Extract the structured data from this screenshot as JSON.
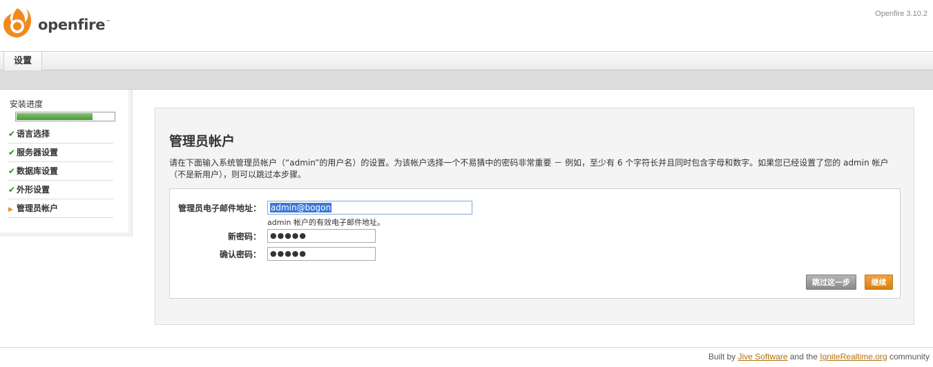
{
  "header": {
    "logo_text": "openfire",
    "logo_tm": "™",
    "version": "Openfire 3.10.2"
  },
  "tabs": [
    {
      "label": "设置"
    }
  ],
  "sidebar": {
    "progress_label": "安装进度",
    "progress_fraction": 0.78,
    "steps": [
      {
        "label": "语言选择",
        "status": "done"
      },
      {
        "label": "服务器设置",
        "status": "done"
      },
      {
        "label": "数据库设置",
        "status": "done"
      },
      {
        "label": "外形设置",
        "status": "done"
      },
      {
        "label": "管理员帐户",
        "status": "current"
      }
    ]
  },
  "main": {
    "title": "管理员帐户",
    "description": "请在下面输入系统管理员帐户（“admin”的用户名）的设置。为该帐户选择一个不易猜中的密码非常重要 － 例如，至少有 6 个字符长并且同时包含字母和数字。如果您已经设置了您的 admin 帐户（不是新用户），则可以跳过本步骤。",
    "form": {
      "email_label": "管理员电子邮件地址：",
      "email_value": "admin@bogon",
      "email_hint": "admin 帐户的有效电子邮件地址。",
      "new_password_label": "新密码：",
      "new_password_value": "●●●●●",
      "confirm_password_label": "确认密码：",
      "confirm_password_value": "●●●●●"
    },
    "buttons": {
      "skip": "跳过这一步",
      "continue": "继续"
    }
  },
  "footer": {
    "prefix": "Built by ",
    "link1": "Jive Software",
    "middle": " and the ",
    "link2": "IgniteRealtime.org",
    "suffix": " community"
  },
  "colors": {
    "accent_orange": "#d97f12",
    "progress_green": "#4a9a3a",
    "link": "#b0700a"
  }
}
